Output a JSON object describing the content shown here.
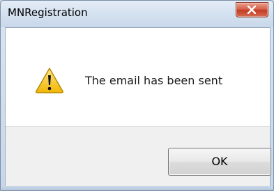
{
  "window": {
    "title": "MNRegistration",
    "close_icon": "close-icon"
  },
  "dialog": {
    "icon": "warning-icon",
    "message": "The email has been sent",
    "ok_label": "OK"
  },
  "colors": {
    "warning_yellow": "#f4c21b",
    "close_button_red": "#c9462f"
  }
}
